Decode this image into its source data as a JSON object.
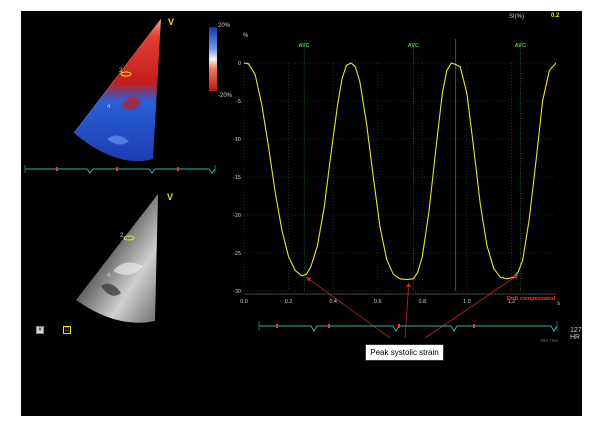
{
  "top_view": {
    "marker": "V",
    "scale_max": "20%",
    "scale_min": "-20%",
    "segment_labels": [
      "2",
      "4"
    ]
  },
  "bottom_view": {
    "marker": "V",
    "segment_labels": [
      "2",
      "4"
    ]
  },
  "toolbar": {
    "btn1_label": "#",
    "btn2_label": "□"
  },
  "plot_header": {
    "param_label": "SI(%)",
    "param_value": "0.2",
    "y_unit": "%",
    "x_unit": "s"
  },
  "colors": {
    "strain_curve": "#e6e635",
    "ecg_trace": "#2fb3a0",
    "avc_line": "#3a9a3a",
    "grid": "#4a4a4a",
    "marker_red": "#ff3030"
  },
  "hr_readout": {
    "value": "127",
    "unit": "HR",
    "small_text": "TRG TRG"
  },
  "annotations": {
    "drift": "Drift compensated",
    "callout": "Peak systolic strain"
  },
  "chart_data": {
    "type": "line",
    "title": "",
    "xlabel": "s",
    "ylabel": "%",
    "xlim": [
      0,
      1.4
    ],
    "ylim": [
      -30,
      0
    ],
    "x_ticks": [
      0.0,
      0.2,
      0.4,
      0.6,
      0.8,
      1.0,
      1.2
    ],
    "x_tick_labels": [
      "0.0",
      "0.2",
      "0.4",
      "0.6",
      "0.8",
      "1.0",
      "1.2"
    ],
    "y_ticks": [
      0,
      -5,
      -10,
      -15,
      -20,
      -25,
      -30
    ],
    "y_tick_labels": [
      "0",
      "-5",
      "-10",
      "-15",
      "-20",
      "-25",
      "-30"
    ],
    "grid": true,
    "avc_label": "AVC",
    "avc_times": [
      0.27,
      0.76,
      1.24
    ],
    "marker_time": 0.95,
    "series": [
      {
        "x": [
          0.0,
          0.02,
          0.05,
          0.08,
          0.11,
          0.14,
          0.17,
          0.2,
          0.23,
          0.26,
          0.28,
          0.3,
          0.33,
          0.36,
          0.39,
          0.42,
          0.44,
          0.46,
          0.48,
          0.5,
          0.52,
          0.55,
          0.58,
          0.61,
          0.64,
          0.67,
          0.7,
          0.73,
          0.76,
          0.78,
          0.8,
          0.83,
          0.86,
          0.89,
          0.91,
          0.93,
          0.95,
          0.97,
          1.0,
          1.03,
          1.06,
          1.09,
          1.12,
          1.15,
          1.18,
          1.21,
          1.23,
          1.25,
          1.28,
          1.31,
          1.34,
          1.37,
          1.4
        ],
        "y": [
          0.0,
          -0.1,
          -1.5,
          -5.5,
          -11.0,
          -17.0,
          -22.0,
          -25.5,
          -27.3,
          -28.0,
          -27.8,
          -26.8,
          -24.0,
          -19.0,
          -12.0,
          -5.5,
          -2.0,
          -0.3,
          0.0,
          -0.5,
          -2.5,
          -8.0,
          -15.0,
          -21.5,
          -25.8,
          -27.8,
          -28.4,
          -28.5,
          -28.4,
          -27.5,
          -25.5,
          -19.5,
          -11.5,
          -4.0,
          -1.0,
          0.0,
          -0.2,
          -0.5,
          -4.0,
          -11.0,
          -18.5,
          -24.0,
          -27.0,
          -28.2,
          -28.4,
          -28.2,
          -27.5,
          -26.0,
          -20.5,
          -13.0,
          -5.0,
          -1.0,
          0.0
        ]
      }
    ],
    "peak_times": [
      0.28,
      0.74,
      1.23
    ]
  }
}
